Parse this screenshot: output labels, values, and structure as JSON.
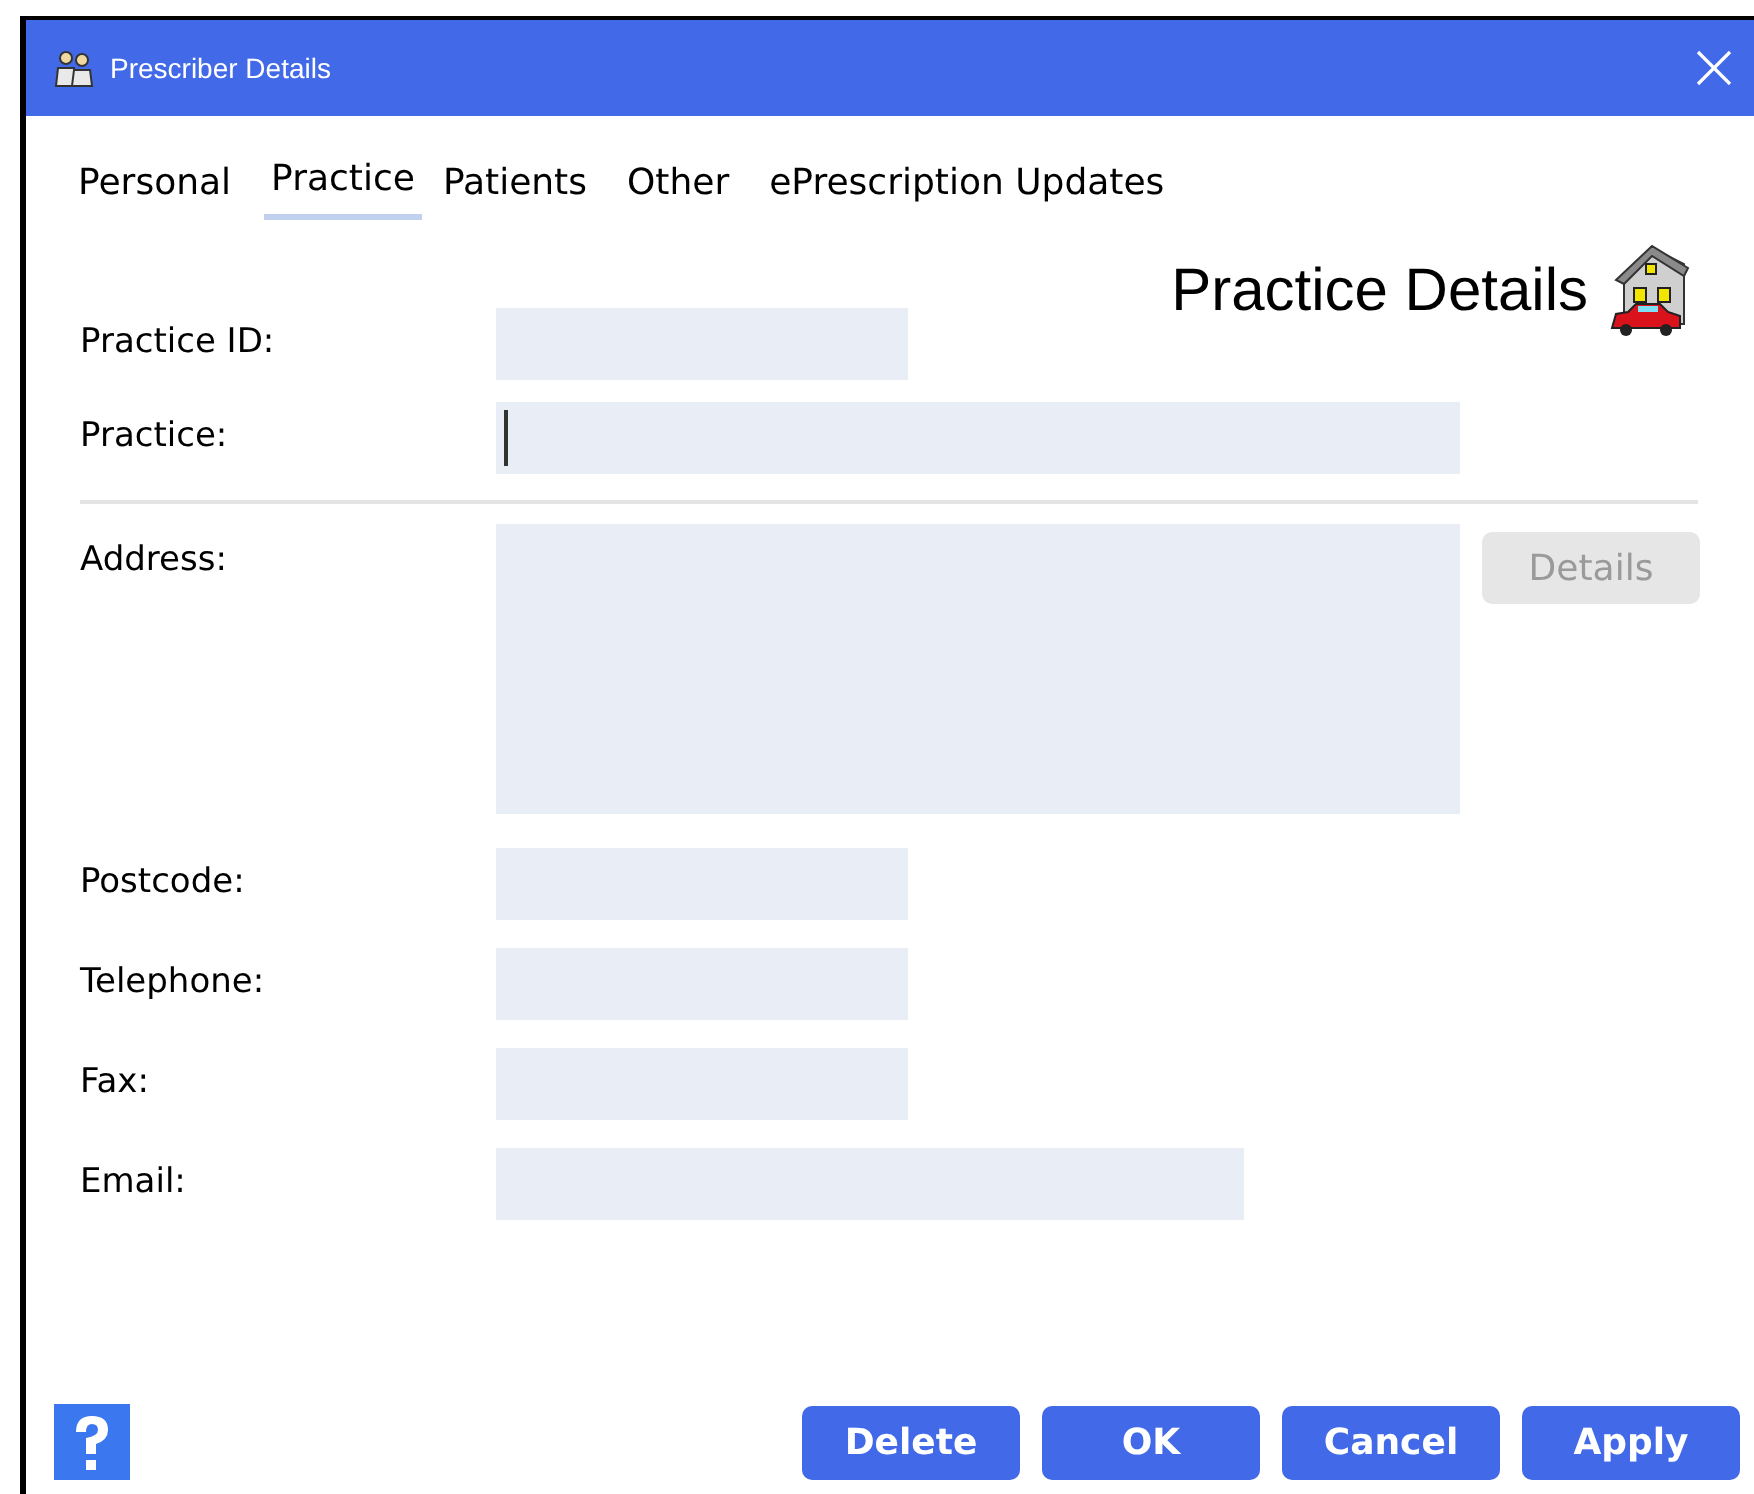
{
  "window": {
    "title": "Prescriber Details"
  },
  "tabs": [
    {
      "label": "Personal",
      "selected": false
    },
    {
      "label": "Practice",
      "selected": true
    },
    {
      "label": "Patients",
      "selected": false
    },
    {
      "label": "Other",
      "selected": false
    },
    {
      "label": "ePrescription Updates",
      "selected": false
    }
  ],
  "heading": "Practice Details",
  "fields_top": [
    {
      "label": "Practice ID:",
      "focused": false
    },
    {
      "label": "Practice:",
      "focused": true
    }
  ],
  "address": {
    "label": "Address:",
    "button": {
      "label": "Details",
      "disabled": true
    }
  },
  "fields_bottom": [
    {
      "label": "Postcode:",
      "focused": false
    },
    {
      "label": "Telephone:",
      "focused": false
    },
    {
      "label": "Fax:",
      "focused": false
    },
    {
      "label": "Email:",
      "focused": false
    }
  ],
  "buttons": [
    {
      "label": "Delete"
    },
    {
      "label": "OK"
    },
    {
      "label": "Cancel"
    },
    {
      "label": "Apply"
    }
  ]
}
